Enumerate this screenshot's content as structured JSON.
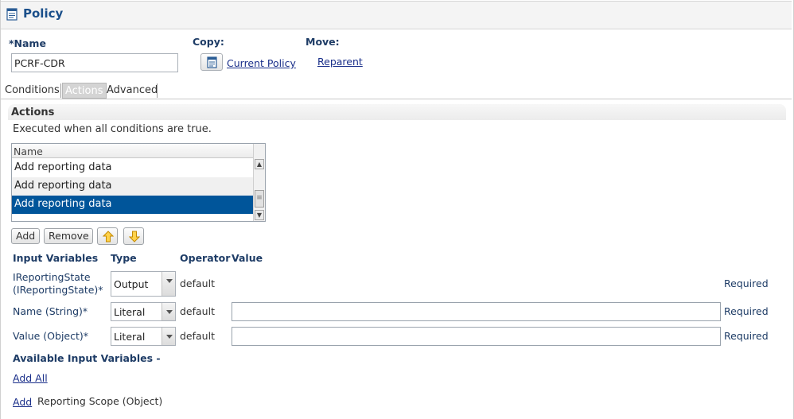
{
  "header": {
    "title": "Policy",
    "icon": "document-icon"
  },
  "form": {
    "name_label": "*Name",
    "name_value": "PCRF-CDR",
    "copy_label": "Copy:",
    "copy_link": "Current Policy",
    "copy_icon": "copy-document-icon",
    "move_label": "Move:",
    "move_link": "Reparent"
  },
  "tabs": [
    {
      "label": "Conditions",
      "active": false
    },
    {
      "label": "Actions",
      "active": true
    },
    {
      "label": "Advanced",
      "active": false
    }
  ],
  "actions": {
    "title": "Actions",
    "description": "Executed when all conditions are true.",
    "list_header": "Name",
    "items": [
      {
        "label": "Add reporting data",
        "selected": false
      },
      {
        "label": "Add reporting data",
        "selected": false
      },
      {
        "label": "Add reporting data",
        "selected": true
      }
    ],
    "add_button": "Add",
    "remove_button": "Remove",
    "move_up_icon": "arrow-up-icon",
    "move_down_icon": "arrow-down-icon"
  },
  "variables": {
    "headers": {
      "input": "Input Variables",
      "type": "Type",
      "operator": "Operator",
      "value": "Value"
    },
    "rows": [
      {
        "label": "IReportingState (IReportingState)*",
        "type": "Output",
        "operator": "default",
        "value": "",
        "required": "Required"
      },
      {
        "label": "Name (String)*",
        "type": "Literal",
        "operator": "default",
        "value": "",
        "required": "Required"
      },
      {
        "label": "Value (Object)*",
        "type": "Literal",
        "operator": "default",
        "value": "",
        "required": "Required"
      }
    ]
  },
  "available": {
    "title": "Available Input Variables -",
    "add_all": "Add All",
    "add_link": "Add",
    "item": "Reporting Scope (Object)"
  },
  "colors": {
    "accent": "#1a4f8a",
    "selection": "#00559a",
    "link": "#1a2f8a",
    "arrow": "#f0b400"
  }
}
